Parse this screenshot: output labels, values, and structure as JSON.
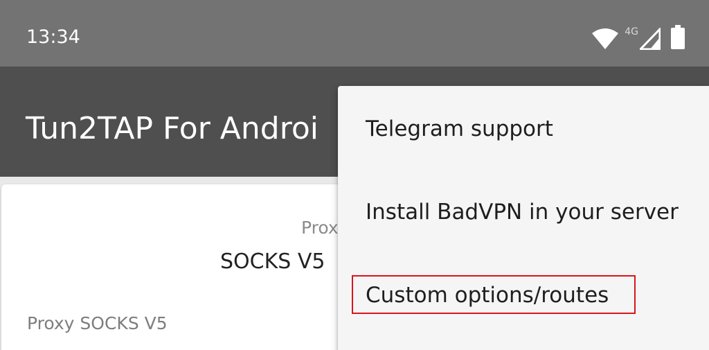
{
  "status_bar": {
    "time": "13:34",
    "network_type": "4G",
    "icons": [
      "wifi-icon",
      "signal-icon",
      "battery-icon"
    ]
  },
  "app_bar": {
    "title": "Tun2TAP For Androi"
  },
  "content": {
    "proxy_label_small": "Prox",
    "proxy_value": "SOCKS V5",
    "proxy_field_label": "Proxy SOCKS V5"
  },
  "overflow_menu": {
    "items": [
      {
        "label": "Telegram support"
      },
      {
        "label": "Install BadVPN in your server"
      },
      {
        "label": "Custom options/routes"
      }
    ],
    "highlighted_item": "Custom options/routes"
  },
  "colors": {
    "status_bar": "#737373",
    "app_bar": "#4f4f4f",
    "menu_background": "#f5f5f5",
    "highlight_border": "#d9141c"
  }
}
